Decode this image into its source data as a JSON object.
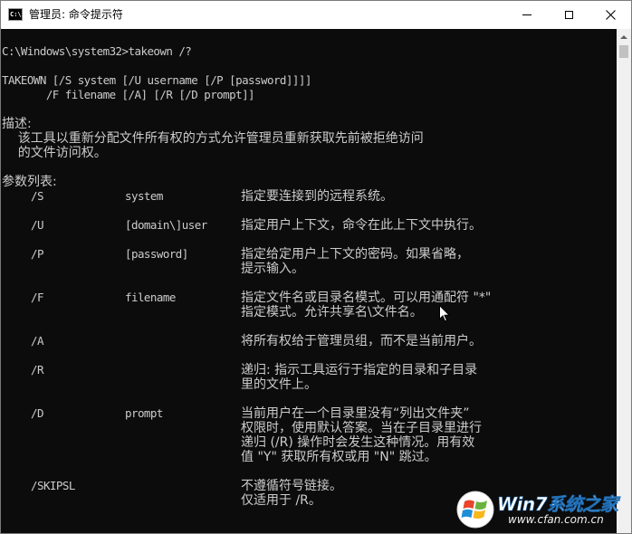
{
  "window": {
    "title": "管理员: 命令提示符",
    "icon_text": "C:\\"
  },
  "console": {
    "prompt_line": "C:\\Windows\\system32>takeown /?",
    "usage_line1": "TAKEOWN [/S system [/U username [/P [password]]]]",
    "usage_line2": "       /F filename [/A] [/R [/D prompt]]",
    "desc_header": "描述:",
    "desc_line1": "    该工具以重新分配文件所有权的方式允许管理员重新获取先前被拒绝访问",
    "desc_line2": "    的文件访问权。",
    "params_header": "参数列表:",
    "params": [
      {
        "flag": "/S",
        "arg": "system",
        "desc": [
          "指定要连接到的远程系统。"
        ]
      },
      {
        "flag": "/U",
        "arg": "[domain\\]user",
        "desc": [
          "指定用户上下文，命令在此上下文中执行。"
        ]
      },
      {
        "flag": "/P",
        "arg": "[password]",
        "desc": [
          "指定给定用户上下文的密码。如果省略，",
          "提示输入。"
        ]
      },
      {
        "flag": "/F",
        "arg": "filename",
        "desc": [
          "指定文件名或目录名模式。可以用通配符 \"*\"",
          "指定模式。允许共享名\\文件名。"
        ]
      },
      {
        "flag": "/A",
        "arg": "",
        "desc": [
          "将所有权给于管理员组，而不是当前用户。"
        ]
      },
      {
        "flag": "/R",
        "arg": "",
        "desc": [
          "递归: 指示工具运行于指定的目录和子目录",
          "里的文件上。"
        ]
      },
      {
        "flag": "/D",
        "arg": "prompt",
        "desc": [
          "当前用户在一个目录里没有“列出文件夹”",
          "权限时，使用默认答案。当在子目录里进行",
          "递归 (/R) 操作时会发生这种情况。用有效",
          "值 \"Y\" 获取所有权或用 \"N\" 跳过。"
        ]
      },
      {
        "flag": "/SKIPSL",
        "arg": "",
        "desc": [
          "不遵循符号链接。",
          "仅适用于 /R。"
        ]
      }
    ]
  },
  "watermark": {
    "brand": "Win7系统之家",
    "url": "www.cfan.com.cn"
  },
  "colors": {
    "console_bg": "#0c0c0c",
    "console_fg": "#cccccc",
    "titlebar_bg": "#ffffff"
  }
}
